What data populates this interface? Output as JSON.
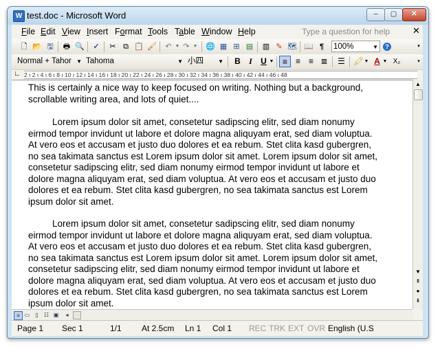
{
  "window": {
    "title": "test.doc - Microsoft Word",
    "app_icon": "W"
  },
  "window_controls": {
    "minimize": "–",
    "maximize": "▢",
    "close": "✕"
  },
  "menu": {
    "items": [
      {
        "pre": "",
        "key": "F",
        "rest": "ile"
      },
      {
        "pre": "",
        "key": "E",
        "rest": "dit"
      },
      {
        "pre": "",
        "key": "V",
        "rest": "iew"
      },
      {
        "pre": "",
        "key": "I",
        "rest": "nsert"
      },
      {
        "pre": "F",
        "key": "o",
        "rest": "rmat"
      },
      {
        "pre": "",
        "key": "T",
        "rest": "ools"
      },
      {
        "pre": "T",
        "key": "a",
        "rest": "ble"
      },
      {
        "pre": "",
        "key": "W",
        "rest": "indow"
      },
      {
        "pre": "",
        "key": "H",
        "rest": "elp"
      }
    ],
    "ask_placeholder": "Type a question for help",
    "close_glyph": "✕"
  },
  "standard_toolbar": {
    "zoom": "100%",
    "undo": "↶",
    "redo": "↷",
    "help": "?"
  },
  "formatting_toolbar": {
    "style": "Normal + Tahor",
    "font": "Tahoma",
    "size": "小四",
    "bold": "B",
    "italic": "I",
    "underline": "U",
    "font_color_glyph": "A",
    "subscript_glyph": "X₂"
  },
  "ruler": {
    "marks": "2 ı 2 ı 4 ı 6 ı 8 ı 10 ı 12 ı 14 ı 16 ı 18 ı 20 ı 22 ı 24 ı 26 ı 28 ı 30 ı 32 ı 34 ı 36 ı 38 ı 40 ı 42 ı 44 ı 46 ı 48"
  },
  "document": {
    "paragraphs": [
      "This is certainly a nice way to keep focused on writing. Nothing but a background, scrollable writing area, and lots of quiet....",
      "Lorem ipsum dolor sit amet, consetetur sadipscing elitr, sed diam nonumy eirmod tempor invidunt ut labore et dolore magna aliquyam erat, sed diam voluptua. At vero eos et accusam et justo duo dolores et ea rebum. Stet clita kasd gubergren, no sea takimata sanctus est Lorem ipsum dolor sit amet. Lorem ipsum dolor sit amet, consetetur sadipscing elitr, sed diam nonumy eirmod tempor invidunt ut labore et dolore magna aliquyam erat, sed diam voluptua. At vero eos et accusam et justo duo dolores et ea rebum. Stet clita kasd gubergren, no sea takimata sanctus est Lorem ipsum dolor sit amet.",
      "Lorem ipsum dolor sit amet, consetetur sadipscing elitr, sed diam nonumy eirmod tempor invidunt ut labore et dolore magna aliquyam erat, sed diam voluptua. At vero eos et accusam et justo duo dolores et ea rebum. Stet clita kasd gubergren, no sea takimata sanctus est Lorem ipsum dolor sit amet. Lorem ipsum dolor sit amet, consetetur sadipscing elitr, sed diam nonumy eirmod tempor invidunt ut labore et dolore magna aliquyam erat, sed diam voluptua. At vero eos et accusam et justo duo dolores et ea rebum. Stet clita kasd gubergren, no sea takimata sanctus est Lorem ipsum dolor sit amet."
    ]
  },
  "status": {
    "page": "Page 1",
    "sec": "Sec 1",
    "pages": "1/1",
    "at": "At 2.5cm",
    "ln": "Ln 1",
    "col": "Col 1",
    "rec": "REC",
    "trk": "TRK",
    "ext": "EXT",
    "ovr": "OVR",
    "lang": "English (U.S"
  },
  "colors": {
    "title_bar": "#cfe3f2",
    "chrome": "#f4f2ec",
    "accent": "#316ac5"
  }
}
